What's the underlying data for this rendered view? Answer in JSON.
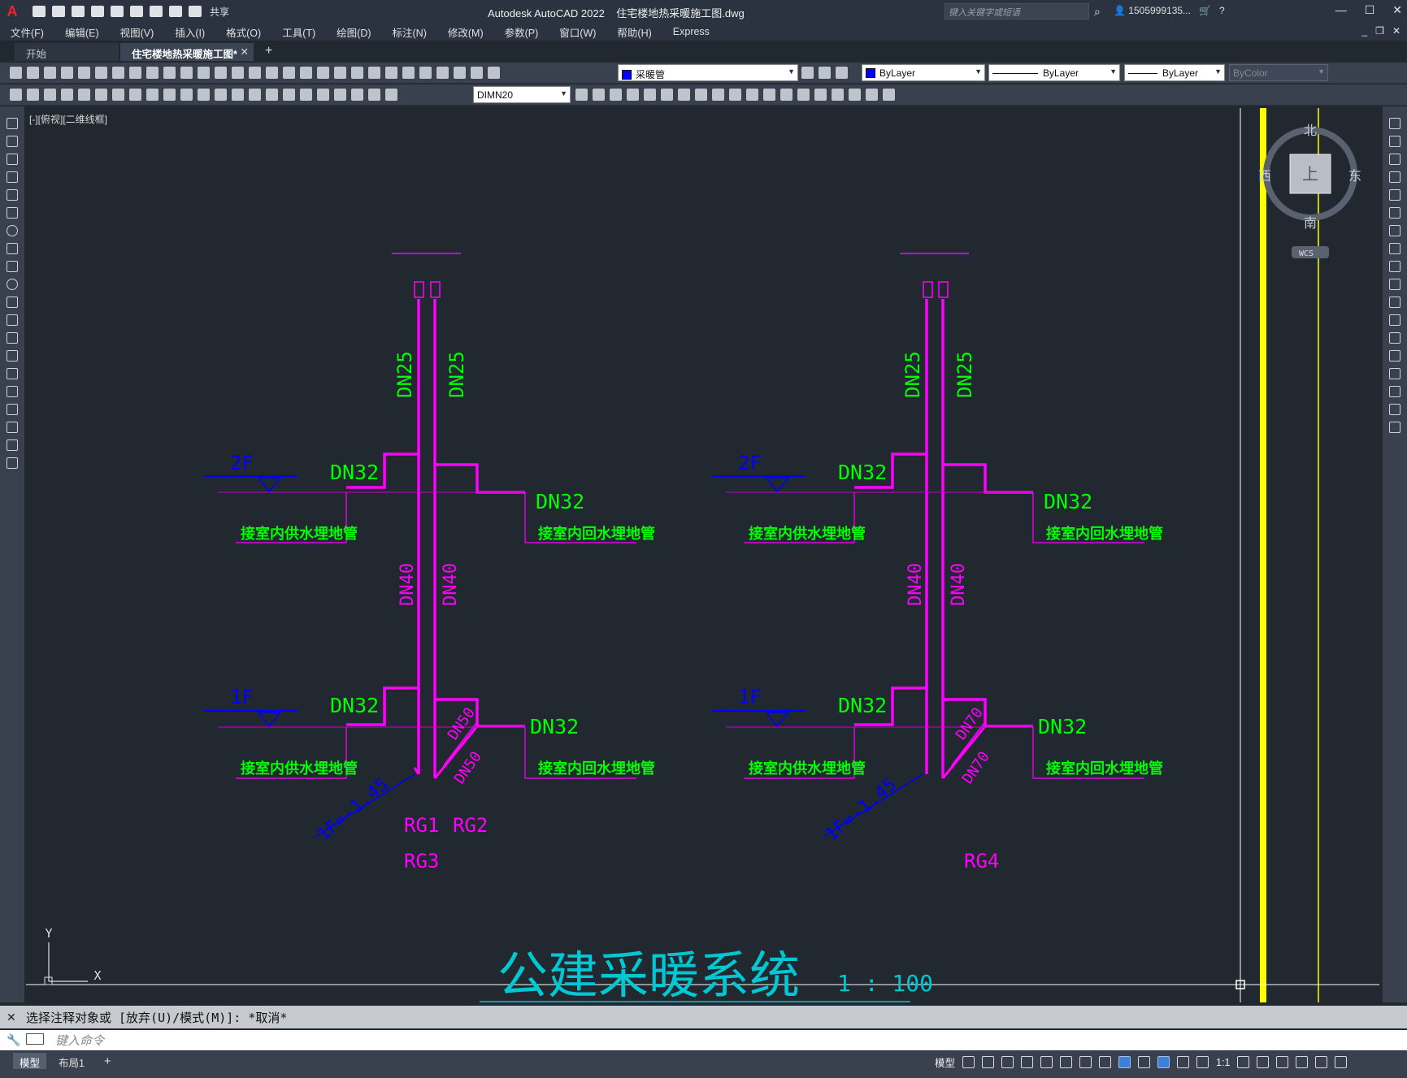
{
  "app": {
    "logo": "A",
    "title": "Autodesk AutoCAD 2022",
    "document": "住宅楼地热采暖施工图.dwg",
    "share": "共享",
    "search_placeholder": "键入关键字或短语",
    "user": "1505999135...",
    "help": "?"
  },
  "menu": [
    "文件(F)",
    "编辑(E)",
    "视图(V)",
    "插入(I)",
    "格式(O)",
    "工具(T)",
    "绘图(D)",
    "标注(N)",
    "修改(M)",
    "参数(P)",
    "窗口(W)",
    "帮助(H)",
    "Express"
  ],
  "tabs": {
    "start": "开始",
    "active": "住宅楼地热采暖施工图*"
  },
  "toolbar": {
    "layer": "采暖管",
    "color": "ByLayer",
    "linetype": "ByLayer",
    "lineweight": "ByLayer",
    "plotstyle": "ByColor",
    "dimstyle": "DIMN20"
  },
  "viewport_label": "[-][俯视][二维线框]",
  "viewcube": {
    "north": "北",
    "south": "南",
    "east": "东",
    "west": "西",
    "face": "上",
    "wcs": "WCS"
  },
  "drawing": {
    "risers": [
      {
        "supply_upper": "DN25",
        "return_upper": "DN25",
        "supply_lower": "DN40",
        "return_lower": "DN40",
        "branch_2f_left": "DN32",
        "branch_2f_right": "DN32",
        "branch_1f_left": "DN32",
        "branch_1f_right": "DN32",
        "floor_2f": "2F",
        "floor_1f": "1F",
        "supply_label_2f": "接室内供水埋地管",
        "return_label_2f": "接室内回水埋地管",
        "supply_label_1f": "接室内供水埋地管",
        "return_label_1f": "接室内回水埋地管",
        "main_pipe_a": "DN50",
        "main_pipe_b": "DN50",
        "elevation": "1F=-1.45",
        "tags": [
          "RG1",
          "RG2",
          "RG3"
        ]
      },
      {
        "supply_upper": "DN25",
        "return_upper": "DN25",
        "supply_lower": "DN40",
        "return_lower": "DN40",
        "branch_2f_left": "DN32",
        "branch_2f_right": "DN32",
        "branch_1f_left": "DN32",
        "branch_1f_right": "DN32",
        "floor_2f": "2F",
        "floor_1f": "1F",
        "supply_label_2f": "接室内供水埋地管",
        "return_label_2f": "接室内回水埋地管",
        "supply_label_1f": "接室内供水埋地管",
        "return_label_1f": "接室内回水埋地管",
        "main_pipe_a": "DN70",
        "main_pipe_b": "DN70",
        "elevation": "1F=-1.45",
        "tags": [
          "RG4"
        ]
      }
    ],
    "title": "公建采暖系统",
    "scale": "1 : 100",
    "ucs_x": "X",
    "ucs_y": "Y",
    "colors": {
      "pipe": "#ff00ff",
      "text_green": "#00ff00",
      "blue": "#0000ff",
      "cyan": "#00c8d2",
      "yellow": "#ffff00"
    }
  },
  "command": {
    "history": "选择注释对象或 [放弃(U)/模式(M)]: *取消*",
    "placeholder": "键入命令"
  },
  "status": {
    "model": "模型",
    "layout1": "布局1",
    "model_space": "模型",
    "annoscale": "1:1"
  }
}
